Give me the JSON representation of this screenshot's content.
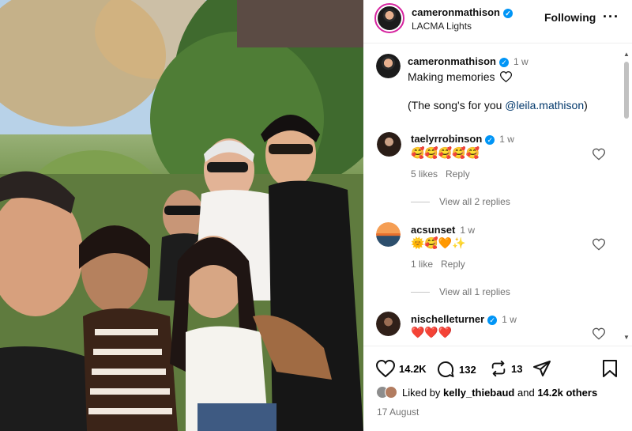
{
  "photo": {
    "alt_icon": "group-selfie-photo"
  },
  "header": {
    "username": "cameronmathison",
    "location": "LACMA Lights",
    "follow_label": "Following",
    "more_icon": "more-icon"
  },
  "caption": {
    "username": "cameronmathison",
    "time": "1 w",
    "line1": "Making memories",
    "line2_prefix": "(The song's for you ",
    "mention": "@leila.mathison",
    "line2_suffix": ")"
  },
  "comments": [
    {
      "username": "taelyrrobinson",
      "time": "1 w",
      "text": "🥰🥰🥰🥰🥰",
      "likes": "5 likes",
      "reply": "Reply",
      "view_replies": "View all 2 replies"
    },
    {
      "username": "acsunset",
      "time": "1 w",
      "text": "🌞🥰🧡✨",
      "likes": "1 like",
      "reply": "Reply",
      "view_replies": "View all 1 replies"
    },
    {
      "username": "nischelleturner",
      "time": "1 w",
      "text": "❤️❤️❤️"
    }
  ],
  "actions": {
    "likes": "14.2K",
    "comments": "132",
    "reposts": "13",
    "liked_by_prefix": "Liked by ",
    "liked_by_user": "kelly_thiebaud",
    "liked_by_and": " and ",
    "liked_by_others": "14.2k others",
    "date": "17 August"
  },
  "colors": {
    "verified": "#0095f6",
    "link": "#00376b",
    "muted": "#737373",
    "like_heart": "#d62a3a"
  }
}
